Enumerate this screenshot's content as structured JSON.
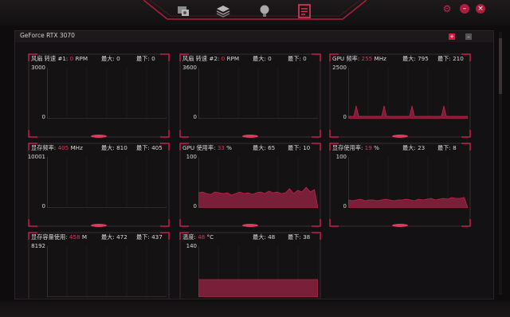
{
  "panel": {
    "title": "GeForce RTX 3070",
    "add_label": "+",
    "min_label": "–"
  },
  "window_buttons": [
    {
      "icon": "gear-icon",
      "label": "⚙"
    },
    {
      "icon": "minimize-icon",
      "label": "–"
    },
    {
      "icon": "close-icon",
      "label": "×"
    }
  ],
  "nav": [
    {
      "name": "nav-system-icon"
    },
    {
      "name": "nav-layers-icon"
    },
    {
      "name": "nav-lightbulb-icon"
    },
    {
      "name": "nav-monitor-icon"
    }
  ],
  "accent": "#e8305a",
  "cards": [
    {
      "label": "风扇 转速 #1: ",
      "value": "0",
      "unit": " RPM",
      "max": "最大: 0",
      "min": "最下: 0",
      "ymax": "3000",
      "ymin": "0",
      "type": "flat"
    },
    {
      "label": "风扇 转速 #2: ",
      "value": "0",
      "unit": " RPM",
      "max": "最大: 0",
      "min": "最下: 0",
      "ymax": "3600",
      "ymin": "0",
      "type": "flat"
    },
    {
      "label": "GPU 频率: ",
      "value": "255",
      "unit": " MHz",
      "max": "最大: 795",
      "min": "最下: 210",
      "ymax": "2500",
      "ymin": "0",
      "type": "spikes"
    },
    {
      "label": "显存频率: ",
      "value": "405",
      "unit": " MHz",
      "max": "最大: 810",
      "min": "最下: 405",
      "ymax": "10001",
      "ymin": "0",
      "type": "flat"
    },
    {
      "label": "GPU 使用率: ",
      "value": "33",
      "unit": " %",
      "max": "最大: 65",
      "min": "最下: 10",
      "ymax": "100",
      "ymin": "0",
      "type": "usage"
    },
    {
      "label": "显存使用率: ",
      "value": "19",
      "unit": " %",
      "max": "最大: 23",
      "min": "最下: 8",
      "ymax": "100",
      "ymin": "0",
      "type": "mem"
    },
    {
      "label": "显存容量使用: ",
      "value": "458",
      "unit": " M",
      "max": "最大: 472",
      "min": "最下: 437",
      "ymax": "8192",
      "ymin": "",
      "type": "none"
    },
    {
      "label": "温度: ",
      "value": "48",
      "unit": " °C",
      "max": "最大: 48",
      "min": "最下: 38",
      "ymax": "140",
      "ymin": "",
      "type": "temp"
    }
  ]
}
